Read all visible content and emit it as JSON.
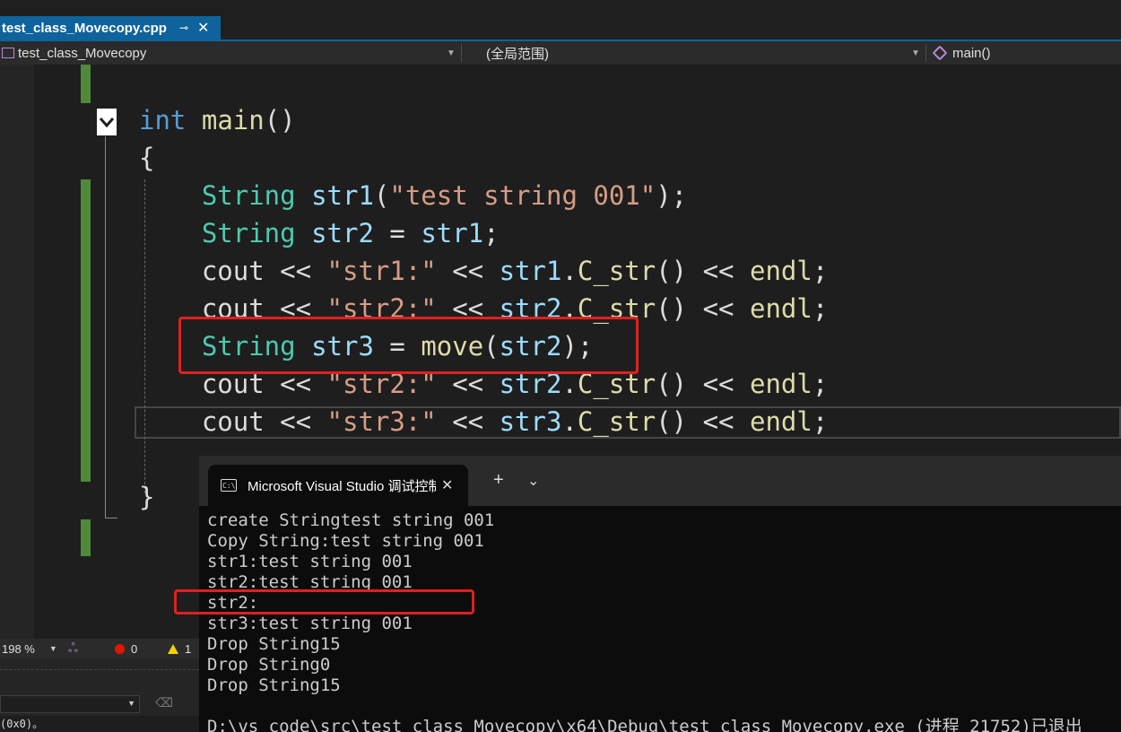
{
  "file_tab": {
    "name": "test_class_Movecopy.cpp",
    "pin": "⊸",
    "close": "✕"
  },
  "navbar": {
    "project": "test_class_Movecopy",
    "scope": "(全局范围)",
    "member": "main()"
  },
  "code_lines": [
    [
      {
        "t": "int",
        "c": "kw"
      },
      {
        "t": " "
      },
      {
        "t": "main",
        "c": "fn"
      },
      {
        "t": "()"
      }
    ],
    [
      {
        "t": "{"
      }
    ],
    [
      {
        "t": "    "
      },
      {
        "t": "String",
        "c": "ty"
      },
      {
        "t": " "
      },
      {
        "t": "str1",
        "c": "va"
      },
      {
        "t": "("
      },
      {
        "t": "\"test string 001\"",
        "c": "st"
      },
      {
        "t": ");"
      }
    ],
    [
      {
        "t": "    "
      },
      {
        "t": "String",
        "c": "ty"
      },
      {
        "t": " "
      },
      {
        "t": "str2",
        "c": "va"
      },
      {
        "t": " = "
      },
      {
        "t": "str1",
        "c": "va"
      },
      {
        "t": ";"
      }
    ],
    [
      {
        "t": "    "
      },
      {
        "t": "cout",
        "c": ""
      },
      {
        "t": " << "
      },
      {
        "t": "\"str1:\"",
        "c": "st"
      },
      {
        "t": " << "
      },
      {
        "t": "str1",
        "c": "va"
      },
      {
        "t": "."
      },
      {
        "t": "C_str",
        "c": "fn"
      },
      {
        "t": "() << "
      },
      {
        "t": "endl",
        "c": "fn"
      },
      {
        "t": ";"
      }
    ],
    [
      {
        "t": "    "
      },
      {
        "t": "cout",
        "c": ""
      },
      {
        "t": " << "
      },
      {
        "t": "\"str2:\"",
        "c": "st"
      },
      {
        "t": " << "
      },
      {
        "t": "str2",
        "c": "va"
      },
      {
        "t": "."
      },
      {
        "t": "C_str",
        "c": "fn"
      },
      {
        "t": "() << "
      },
      {
        "t": "endl",
        "c": "fn"
      },
      {
        "t": ";"
      }
    ],
    [
      {
        "t": "    "
      },
      {
        "t": "String",
        "c": "ty"
      },
      {
        "t": " "
      },
      {
        "t": "str3",
        "c": "va"
      },
      {
        "t": " = "
      },
      {
        "t": "move",
        "c": "fn"
      },
      {
        "t": "("
      },
      {
        "t": "str2",
        "c": "va"
      },
      {
        "t": ");"
      }
    ],
    [
      {
        "t": "    "
      },
      {
        "t": "cout",
        "c": ""
      },
      {
        "t": " << "
      },
      {
        "t": "\"str2:\"",
        "c": "st"
      },
      {
        "t": " << "
      },
      {
        "t": "str2",
        "c": "va"
      },
      {
        "t": "."
      },
      {
        "t": "C_str",
        "c": "fn"
      },
      {
        "t": "() << "
      },
      {
        "t": "endl",
        "c": "fn"
      },
      {
        "t": ";"
      }
    ],
    [
      {
        "t": "    "
      },
      {
        "t": "cout",
        "c": ""
      },
      {
        "t": " << "
      },
      {
        "t": "\"str3:\"",
        "c": "st"
      },
      {
        "t": " << "
      },
      {
        "t": "str3",
        "c": "va"
      },
      {
        "t": "."
      },
      {
        "t": "C_str",
        "c": "fn"
      },
      {
        "t": "() << "
      },
      {
        "t": "endl",
        "c": "fn"
      },
      {
        "t": ";"
      }
    ],
    [],
    [
      {
        "t": "}"
      }
    ]
  ],
  "status": {
    "zoom": "198 %",
    "errors": "0",
    "warnings": "1"
  },
  "output_snippet": "(0x0)。",
  "terminal": {
    "title": "Microsoft Visual Studio 调试控制台",
    "close": "✕",
    "add": "+",
    "dropdown": "⌄",
    "icon_text": "C:\\",
    "lines": [
      "create Stringtest string 001",
      "Copy String:test string 001",
      "str1:test string 001",
      "str2:test string 001",
      "str2:",
      "str3:test string 001",
      "Drop String15",
      "Drop String0",
      "Drop String15",
      "",
      "D:\\vs code\\src\\test class Movecopy\\x64\\Debug\\test class Movecopy.exe (进程 21752)已退出"
    ]
  },
  "colors": {
    "accent": "#0e639c",
    "highlight": "#e02020",
    "change_bar": "#4e8a3a"
  }
}
